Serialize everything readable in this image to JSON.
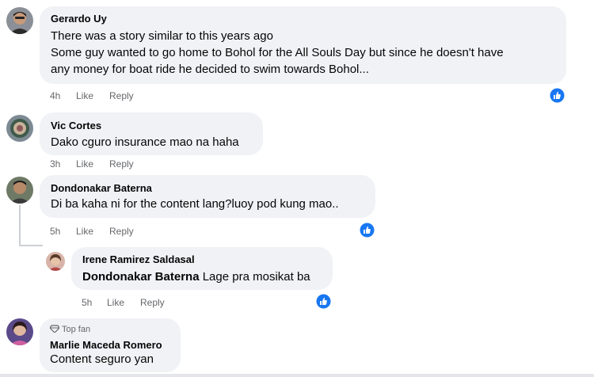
{
  "comments": [
    {
      "author": "Gerardo Uy",
      "line1": "There was a story similar to this years ago",
      "line2": "Some guy wanted to go home to Bohol for the All Souls Day but since he doesn't have",
      "line3": "any money for boat ride he decided to swim towards Bohol...",
      "time": "4h",
      "like_label": "Like",
      "reply_label": "Reply"
    },
    {
      "author": "Vic Cortes",
      "line1": "Dako cguro insurance mao na haha",
      "time": "3h",
      "like_label": "Like",
      "reply_label": "Reply"
    },
    {
      "author": "Dondonakar Baterna",
      "line1": "Di ba kaha ni for the content lang?luoy pod kung mao..",
      "time": "5h",
      "like_label": "Like",
      "reply_label": "Reply"
    },
    {
      "author": "Irene Ramirez Saldasal",
      "mention": "Dondonakar Baterna",
      "line1": "Lage pra mosikat ba",
      "time": "5h",
      "like_label": "Like",
      "reply_label": "Reply"
    },
    {
      "badge": "Top fan",
      "author": "Marlie Maceda Romero",
      "line1": "Content seguro yan"
    }
  ],
  "colors": {
    "bubble": "#f0f2f5",
    "meta_text": "#65676b",
    "like_blue": "#1877f2",
    "thread_line": "#ccd0d5"
  }
}
